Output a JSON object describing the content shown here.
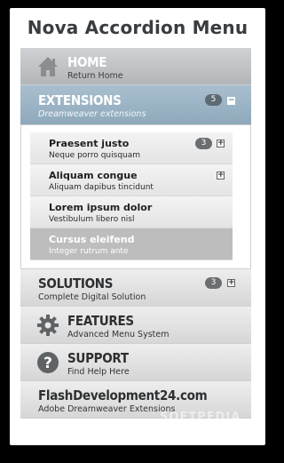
{
  "title": "Nova Accordion Menu",
  "menu": {
    "home": {
      "label": "HOME",
      "sub": "Return Home"
    },
    "extensions": {
      "label": "EXTENSIONS",
      "sub": "Dreamweaver extensions",
      "count": "5",
      "toggle": "−",
      "items": [
        {
          "title": "Praesent justo",
          "sub": "Neque porro quisquam",
          "count": "3",
          "toggle": "+"
        },
        {
          "title": "Aliquam congue",
          "sub": "Aliquam dapibus tincidunt",
          "toggle": "+"
        },
        {
          "title": "Lorem ipsum dolor",
          "sub": "Vestibulum libero nisl"
        },
        {
          "title": "Cursus eleifend",
          "sub": "Integer rutrum ante"
        }
      ]
    },
    "solutions": {
      "label": "SOLUTIONS",
      "sub": "Complete Digital Solution",
      "count": "3",
      "toggle": "+"
    },
    "features": {
      "label": "FEATURES",
      "sub": "Advanced Menu System"
    },
    "support": {
      "label": "SUPPORT",
      "sub": "Find Help Here"
    },
    "flash": {
      "label": "FlashDevelopment24.com",
      "sub": "Adobe Dreamweaver Extensions"
    }
  },
  "watermark": "SOFTPEDIA",
  "icons": {
    "home": "home-icon",
    "features": "gear-icon",
    "support": "question-icon"
  }
}
